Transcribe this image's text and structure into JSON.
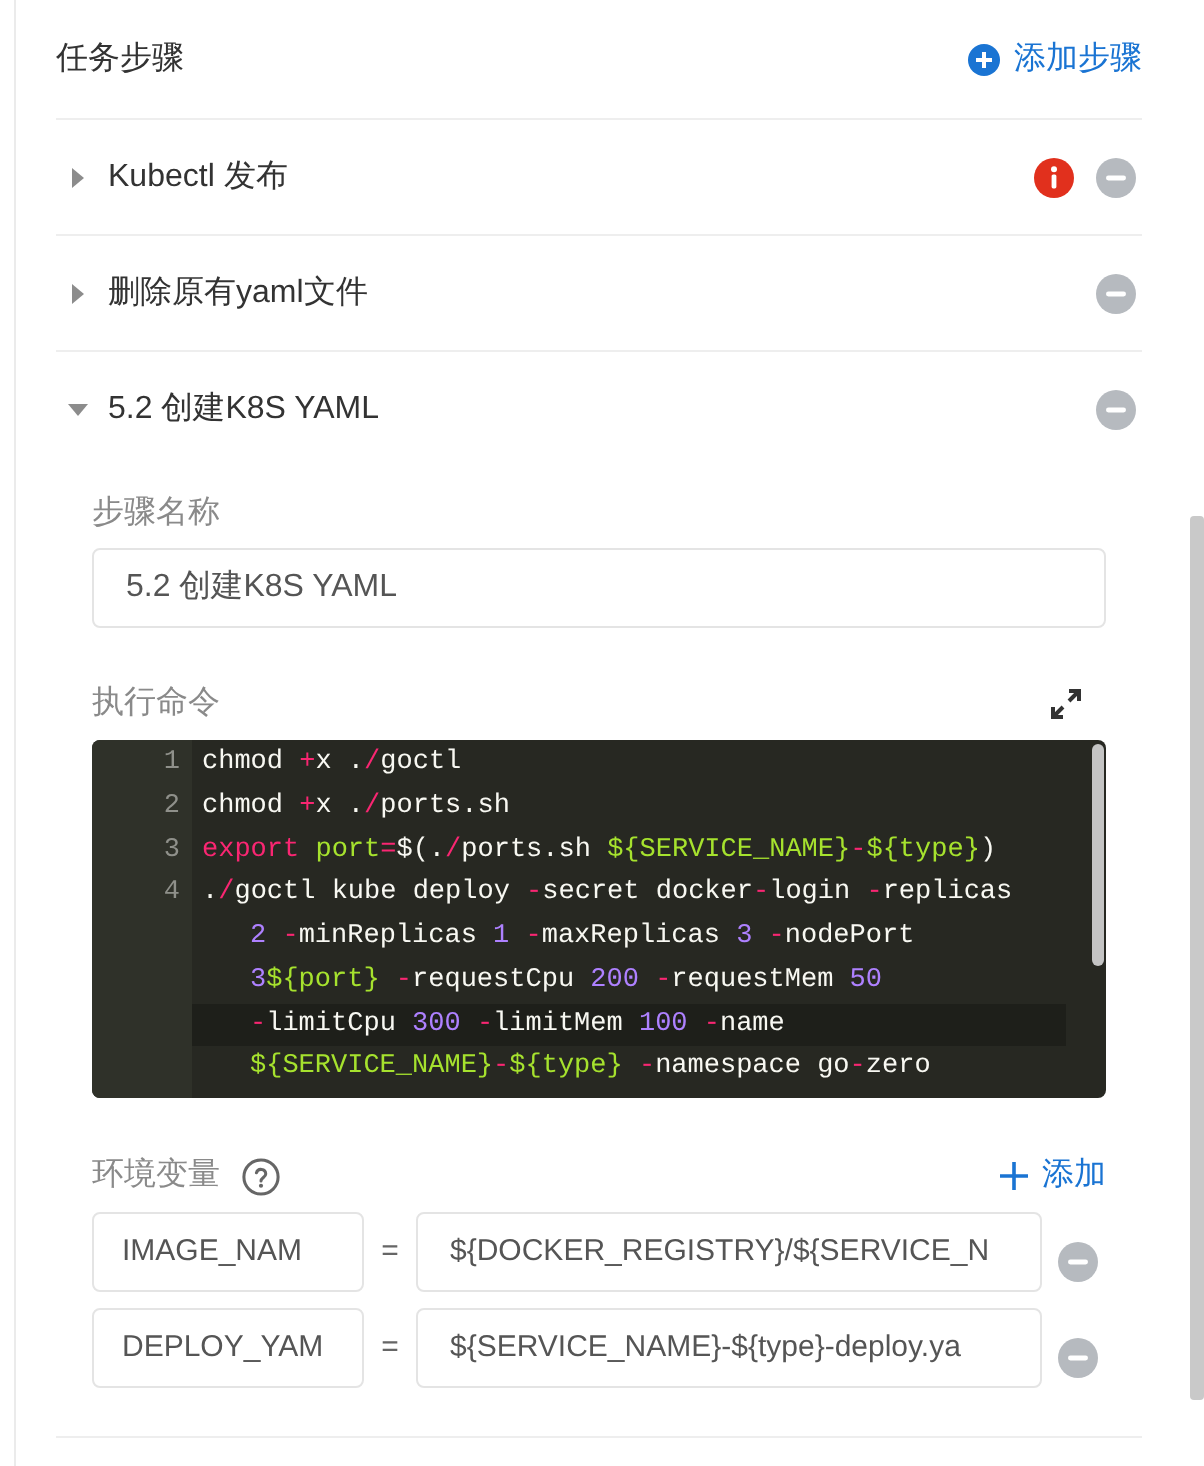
{
  "panel": {
    "title": "任务步骤",
    "add_step_button": "添加步骤"
  },
  "steps": [
    {
      "name": "Kubectl 发布",
      "expanded": false,
      "error": true
    },
    {
      "name": "删除原有yaml文件",
      "expanded": false,
      "error": false
    },
    {
      "name": "5.2 创建K8S YAML",
      "expanded": true,
      "error": false,
      "detail": {
        "name_label": "步骤名称",
        "name_value": "5.2 创建K8S YAML",
        "command_label": "执行命令",
        "code_lines": [
          {
            "number": "1",
            "rows": [
              {
                "active": false,
                "tokens": [
                  {
                    "kind": "text",
                    "text": "chmod "
                  },
                  {
                    "kind": "op",
                    "text": "+"
                  },
                  {
                    "kind": "text",
                    "text": "x ."
                  },
                  {
                    "kind": "op",
                    "text": "/"
                  },
                  {
                    "kind": "text",
                    "text": "goctl"
                  }
                ]
              }
            ]
          },
          {
            "number": "2",
            "rows": [
              {
                "active": false,
                "tokens": [
                  {
                    "kind": "text",
                    "text": "chmod "
                  },
                  {
                    "kind": "op",
                    "text": "+"
                  },
                  {
                    "kind": "text",
                    "text": "x ."
                  },
                  {
                    "kind": "op",
                    "text": "/"
                  },
                  {
                    "kind": "text",
                    "text": "ports.sh"
                  }
                ]
              }
            ]
          },
          {
            "number": "3",
            "rows": [
              {
                "active": false,
                "tokens": [
                  {
                    "kind": "keyword",
                    "text": "export "
                  },
                  {
                    "kind": "var",
                    "text": "port"
                  },
                  {
                    "kind": "op",
                    "text": "="
                  },
                  {
                    "kind": "text",
                    "text": "$(."
                  },
                  {
                    "kind": "op",
                    "text": "/"
                  },
                  {
                    "kind": "text",
                    "text": "ports.sh "
                  },
                  {
                    "kind": "var",
                    "text": "${SERVICE_NAME}"
                  },
                  {
                    "kind": "op",
                    "text": "-"
                  },
                  {
                    "kind": "var",
                    "text": "${type}"
                  },
                  {
                    "kind": "text",
                    "text": ")"
                  }
                ]
              }
            ]
          },
          {
            "number": "4",
            "rows": [
              {
                "active": false,
                "tokens": [
                  {
                    "kind": "text",
                    "text": "."
                  },
                  {
                    "kind": "op",
                    "text": "/"
                  },
                  {
                    "kind": "text",
                    "text": "goctl kube deploy "
                  },
                  {
                    "kind": "op",
                    "text": "-"
                  },
                  {
                    "kind": "text",
                    "text": "secret docker"
                  },
                  {
                    "kind": "op",
                    "text": "-"
                  },
                  {
                    "kind": "text",
                    "text": "login "
                  },
                  {
                    "kind": "op",
                    "text": "-"
                  },
                  {
                    "kind": "text",
                    "text": "replicas"
                  }
                ]
              },
              {
                "active": false,
                "tokens": [
                  {
                    "kind": "num",
                    "text": "2"
                  },
                  {
                    "kind": "op",
                    "text": " -"
                  },
                  {
                    "kind": "text",
                    "text": "minReplicas "
                  },
                  {
                    "kind": "num",
                    "text": "1"
                  },
                  {
                    "kind": "op",
                    "text": " -"
                  },
                  {
                    "kind": "text",
                    "text": "maxReplicas "
                  },
                  {
                    "kind": "num",
                    "text": "3"
                  },
                  {
                    "kind": "op",
                    "text": " -"
                  },
                  {
                    "kind": "text",
                    "text": "nodePort"
                  }
                ]
              },
              {
                "active": false,
                "tokens": [
                  {
                    "kind": "num",
                    "text": "3"
                  },
                  {
                    "kind": "var",
                    "text": "${port}"
                  },
                  {
                    "kind": "op",
                    "text": " -"
                  },
                  {
                    "kind": "text",
                    "text": "requestCpu "
                  },
                  {
                    "kind": "num",
                    "text": "200"
                  },
                  {
                    "kind": "op",
                    "text": " -"
                  },
                  {
                    "kind": "text",
                    "text": "requestMem "
                  },
                  {
                    "kind": "num",
                    "text": "50"
                  }
                ]
              },
              {
                "active": true,
                "tokens": [
                  {
                    "kind": "op",
                    "text": "-"
                  },
                  {
                    "kind": "text",
                    "text": "limitCpu "
                  },
                  {
                    "kind": "num",
                    "text": "300"
                  },
                  {
                    "kind": "op",
                    "text": " -"
                  },
                  {
                    "kind": "text",
                    "text": "limitMem "
                  },
                  {
                    "kind": "num",
                    "text": "100"
                  },
                  {
                    "kind": "op",
                    "text": " -"
                  },
                  {
                    "kind": "text",
                    "text": "name"
                  }
                ]
              },
              {
                "active": false,
                "tokens": [
                  {
                    "kind": "var",
                    "text": "${SERVICE_NAME}"
                  },
                  {
                    "kind": "op",
                    "text": "-"
                  },
                  {
                    "kind": "var",
                    "text": "${type}"
                  },
                  {
                    "kind": "op",
                    "text": " -"
                  },
                  {
                    "kind": "text",
                    "text": "namespace go"
                  },
                  {
                    "kind": "op",
                    "text": "-"
                  },
                  {
                    "kind": "text",
                    "text": "zero"
                  }
                ]
              }
            ]
          }
        ],
        "env_label": "环境变量",
        "env_add_button": "添加",
        "env_vars": [
          {
            "key": "IMAGE_NAM",
            "separator": "=",
            "value": "${DOCKER_REGISTRY}/${SERVICE_N"
          },
          {
            "key": "DEPLOY_YAM",
            "separator": "=",
            "value": "${SERVICE_NAME}-${type}-deploy.ya"
          }
        ]
      }
    }
  ]
}
